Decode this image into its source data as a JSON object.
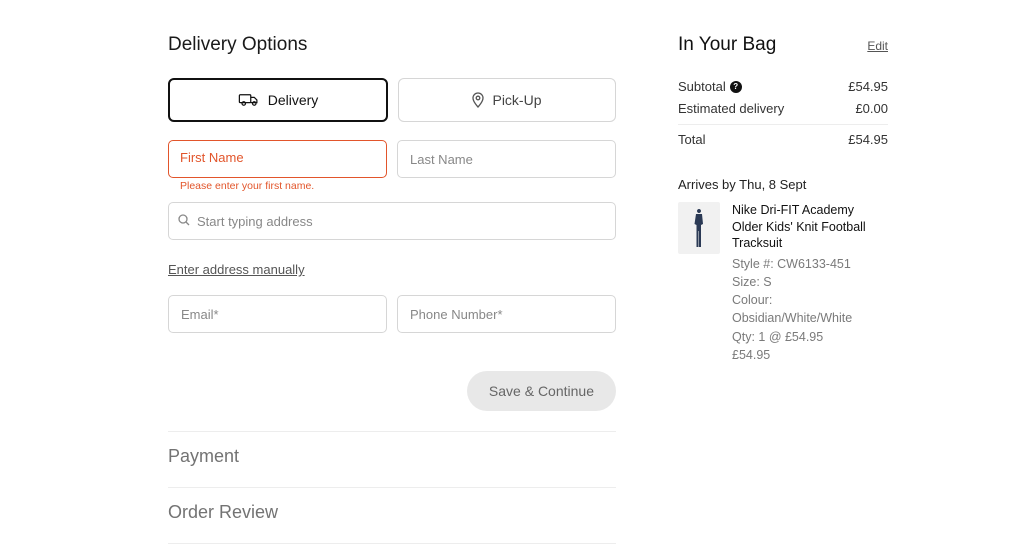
{
  "delivery": {
    "title": "Delivery Options",
    "tabs": {
      "delivery": "Delivery",
      "pickup": "Pick-Up"
    },
    "fields": {
      "first_name": {
        "label": "First Name",
        "error": "Please enter your first name."
      },
      "last_name": {
        "placeholder": "Last Name"
      },
      "address": {
        "placeholder": "Start typing address"
      },
      "manual_link": "Enter address manually",
      "email": {
        "placeholder": "Email*"
      },
      "phone": {
        "placeholder": "Phone Number*"
      }
    },
    "continue": "Save & Continue"
  },
  "steps": {
    "payment": "Payment",
    "review": "Order Review"
  },
  "bag": {
    "title": "In Your Bag",
    "edit": "Edit",
    "summary": {
      "subtotal_label": "Subtotal",
      "subtotal_value": "£54.95",
      "delivery_label": "Estimated delivery",
      "delivery_value": "£0.00",
      "total_label": "Total",
      "total_value": "£54.95"
    },
    "arrive": "Arrives by Thu, 8 Sept",
    "item": {
      "title": "Nike Dri-FIT Academy Older Kids' Knit Football Tracksuit",
      "style": "Style #: CW6133-451",
      "size": "Size: S",
      "colour": "Colour: Obsidian/White/White",
      "qty": "Qty: 1 @ £54.95",
      "price": "£54.95"
    }
  }
}
